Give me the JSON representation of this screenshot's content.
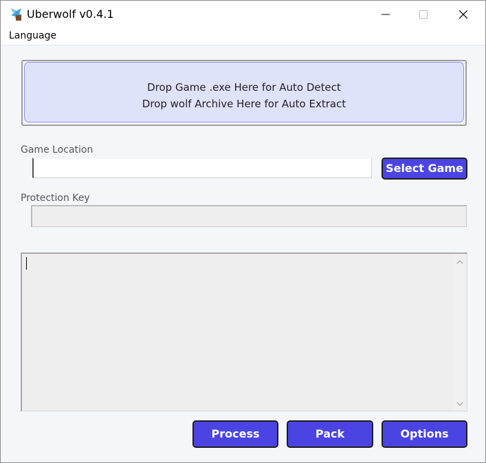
{
  "window": {
    "title": "Uberwolf v0.4.1",
    "icon": "wolf-icon"
  },
  "menubar": {
    "items": [
      {
        "label": "Language"
      }
    ]
  },
  "drop_zone": {
    "line1": "Drop Game .exe Here for Auto Detect",
    "line2": "Drop wolf Archive Here for Auto Extract"
  },
  "game_location": {
    "label": "Game Location",
    "value": "",
    "button_label": "Select Game"
  },
  "protection_key": {
    "label": "Protection Key",
    "value": ""
  },
  "log": {
    "text": ""
  },
  "actions": {
    "process_label": "Process",
    "pack_label": "Pack",
    "options_label": "Options"
  },
  "colors": {
    "button": "#4b44e3",
    "drop_zone_fill": "#dfe2fb",
    "drop_zone_border": "#8f90f0",
    "window_bg": "#f4f6fa"
  }
}
